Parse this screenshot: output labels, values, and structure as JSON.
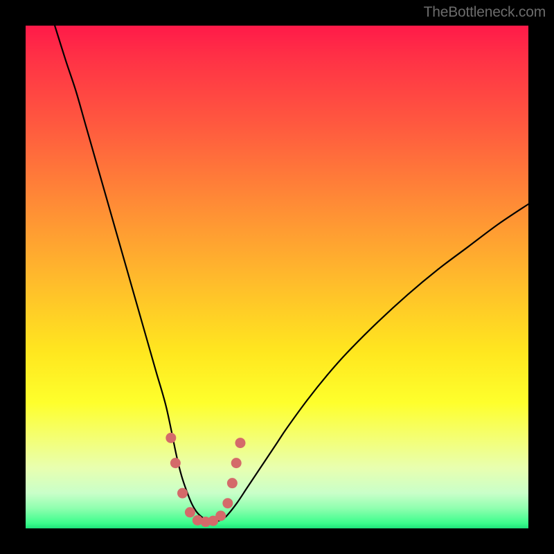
{
  "watermark": "TheBottleneck.com",
  "chart_data": {
    "type": "line",
    "title": "",
    "xlabel": "",
    "ylabel": "",
    "xlim": [
      0,
      100
    ],
    "ylim": [
      0,
      100
    ],
    "series": [
      {
        "name": "bottleneck-curve",
        "color": "#000000",
        "x": [
          5.8,
          8,
          10,
          12,
          14,
          16,
          18,
          20,
          22,
          24,
          26,
          28,
          30,
          31,
          32,
          33,
          34,
          35,
          36,
          37,
          38,
          39,
          40,
          42,
          44,
          46,
          48,
          50,
          52,
          56,
          60,
          64,
          70,
          76,
          82,
          88,
          94,
          100
        ],
        "y": [
          100,
          93,
          87,
          80,
          73,
          66,
          59,
          52,
          45,
          38,
          31,
          24,
          14.5,
          10.5,
          7.5,
          5,
          3.3,
          2.3,
          1.7,
          1.4,
          1.4,
          1.8,
          2.5,
          5,
          8,
          11,
          14,
          17,
          20,
          25.5,
          30.5,
          35,
          41,
          46.5,
          51.5,
          56,
          60.5,
          64.5
        ]
      }
    ],
    "highlight": {
      "name": "low-bottleneck-zone",
      "color": "#d46a6a",
      "points_x": [
        28.9,
        29.8,
        31.2,
        32.7,
        34.2,
        35.8,
        37.3,
        38.8,
        40.2,
        41.1,
        41.9,
        42.7
      ],
      "points_y": [
        18,
        13,
        7,
        3.2,
        1.6,
        1.3,
        1.5,
        2.5,
        5,
        9,
        13,
        17
      ]
    }
  }
}
